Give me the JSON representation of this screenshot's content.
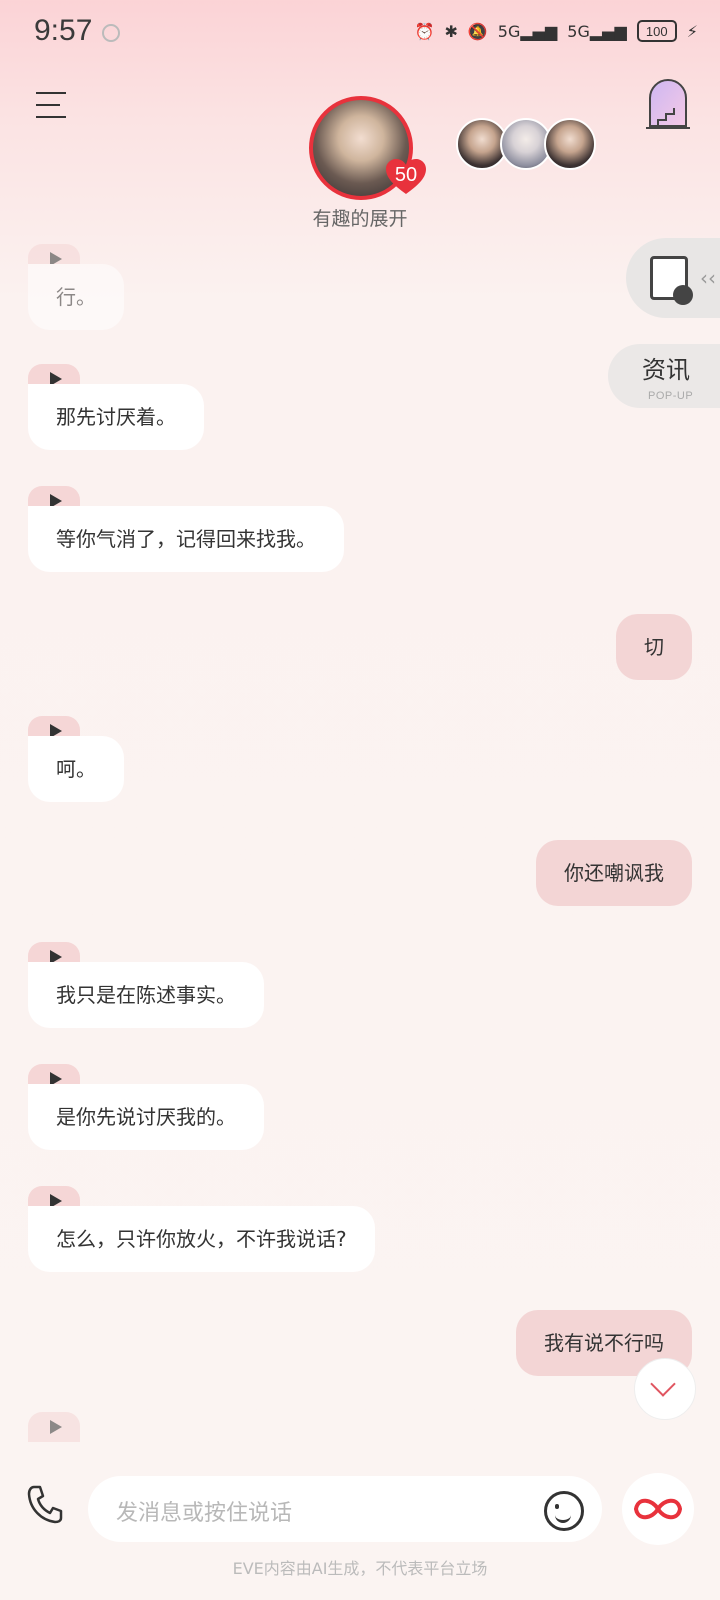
{
  "status_bar": {
    "time": "9:57",
    "network_1": "5G",
    "network_2": "5G",
    "battery": "100"
  },
  "header": {
    "character_name": "有趣的展开",
    "affection_level": "50"
  },
  "side_panel": {
    "news_label": "资讯",
    "news_sublabel": "POP-UP"
  },
  "messages": [
    {
      "from": "ai",
      "text": "行。"
    },
    {
      "from": "ai",
      "text": "那先讨厌着。"
    },
    {
      "from": "ai",
      "text": "等你气消了，记得回来找我。"
    },
    {
      "from": "user",
      "text": "切"
    },
    {
      "from": "ai",
      "text": "呵。"
    },
    {
      "from": "user",
      "text": "你还嘲讽我"
    },
    {
      "from": "ai",
      "text": "我只是在陈述事实。"
    },
    {
      "from": "ai",
      "text": "是你先说讨厌我的。"
    },
    {
      "from": "ai",
      "text": "怎么，只许你放火，不许我说话?"
    },
    {
      "from": "user",
      "text": "我有说不行吗"
    }
  ],
  "input": {
    "placeholder": "发消息或按住说话"
  },
  "footer": {
    "disclaimer": "EVE内容由AI生成，不代表平台立场"
  },
  "colors": {
    "accent": "#e8323c",
    "user_bubble": "#f3d5d5",
    "ai_bubble": "#ffffff"
  }
}
